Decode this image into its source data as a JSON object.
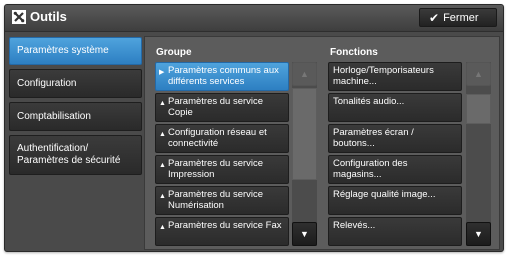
{
  "window": {
    "title": "Outils",
    "close_label": "Fermer"
  },
  "tabs": [
    {
      "label": "Paramètres système",
      "active": true
    },
    {
      "label": "Configuration",
      "active": false
    },
    {
      "label": "Comptabilisation",
      "active": false
    },
    {
      "label": "Authentification/ Paramètres de sécurité",
      "active": false
    }
  ],
  "groupe": {
    "header": "Groupe",
    "items": [
      {
        "label": "Paramètres communs aux différents services",
        "selected": true
      },
      {
        "label": "Paramètres du service Copie",
        "selected": false
      },
      {
        "label": "Configuration réseau et connectivité",
        "selected": false
      },
      {
        "label": "Paramètres du service Impression",
        "selected": false
      },
      {
        "label": "Paramètres du service Numérisation",
        "selected": false
      },
      {
        "label": "Paramètres du service Fax",
        "selected": false
      }
    ]
  },
  "fonctions": {
    "header": "Fonctions",
    "items": [
      {
        "label": "Horloge/Temporisateurs machine..."
      },
      {
        "label": "Tonalités audio..."
      },
      {
        "label": "Paramètres écran / boutons..."
      },
      {
        "label": "Configuration des magasins..."
      },
      {
        "label": "Réglage qualité image..."
      },
      {
        "label": "Relevés..."
      }
    ]
  },
  "icons": {
    "app": "tools-icon",
    "check": "check-icon",
    "arrow_up": "scroll-up-icon",
    "arrow_down": "scroll-down-icon"
  },
  "colors": {
    "accent": "#3a92d4",
    "panel": "#4a4a4a",
    "item": "#2f2f2f",
    "text": "#ffffff"
  }
}
